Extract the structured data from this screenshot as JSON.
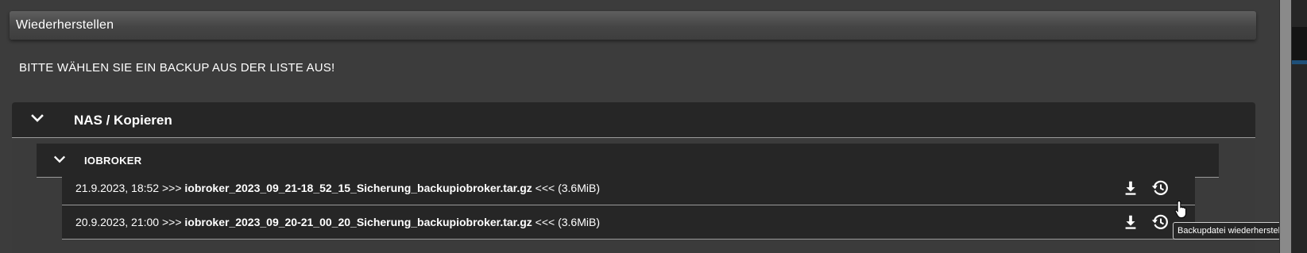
{
  "section": {
    "title": "Wiederherstellen",
    "prompt": "BITTE WÄHLEN SIE EIN BACKUP AUS DER LISTE AUS!"
  },
  "groups": [
    {
      "label": "NAS / Kopieren",
      "icon": "chevron-down-icon",
      "subgroups": [
        {
          "label": "IOBROKER",
          "icon": "chevron-down-icon",
          "files": [
            {
              "date": "21.9.2023, 18:52",
              "arrow_open": ">>>",
              "filename": "iobroker_2023_09_21-18_52_15_Sicherung_backupiobroker.tar.gz",
              "arrow_close": "<<<",
              "size": "(3.6MiB)"
            },
            {
              "date": "20.9.2023, 21:00",
              "arrow_open": ">>>",
              "filename": "iobroker_2023_09_20-21_00_20_Sicherung_backupiobroker.tar.gz",
              "arrow_close": "<<<",
              "size": "(3.6MiB)"
            }
          ]
        }
      ]
    }
  ],
  "row_actions": {
    "download_icon": "download-icon",
    "restore_icon": "restore-history-icon"
  },
  "tooltip": "Backupdatei wiederherstellen",
  "colors": {
    "background": "#3c3c3c",
    "panel": "#262626",
    "divider": "#9a9a9a",
    "text": "#ffffff"
  }
}
